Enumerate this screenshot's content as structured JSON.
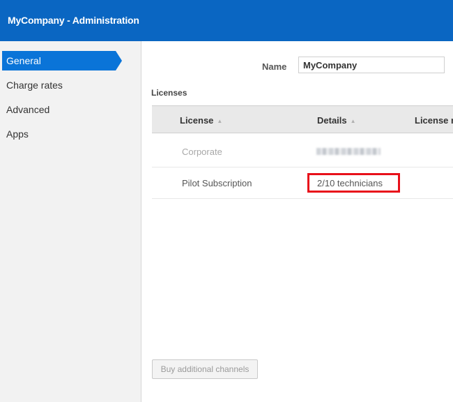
{
  "window": {
    "title": "MyCompany - Administration"
  },
  "sidebar": {
    "items": [
      {
        "label": "General",
        "active": true
      },
      {
        "label": "Charge rates",
        "active": false
      },
      {
        "label": "Advanced",
        "active": false
      },
      {
        "label": "Apps",
        "active": false
      }
    ]
  },
  "form": {
    "name_label": "Name",
    "name_value": "MyCompany"
  },
  "licenses": {
    "section_label": "Licenses",
    "columns": [
      "License",
      "Details",
      "License n"
    ],
    "rows": [
      {
        "license": "Corporate",
        "details": "",
        "details_obscured": true
      },
      {
        "license": "Pilot Subscription",
        "details": "2/10 technicians"
      }
    ]
  },
  "buttons": {
    "buy_channels": "Buy additional channels"
  },
  "colors": {
    "title_bar": "#0a66c2",
    "active_nav": "#0a74d8",
    "highlight_box": "#e8101a"
  }
}
